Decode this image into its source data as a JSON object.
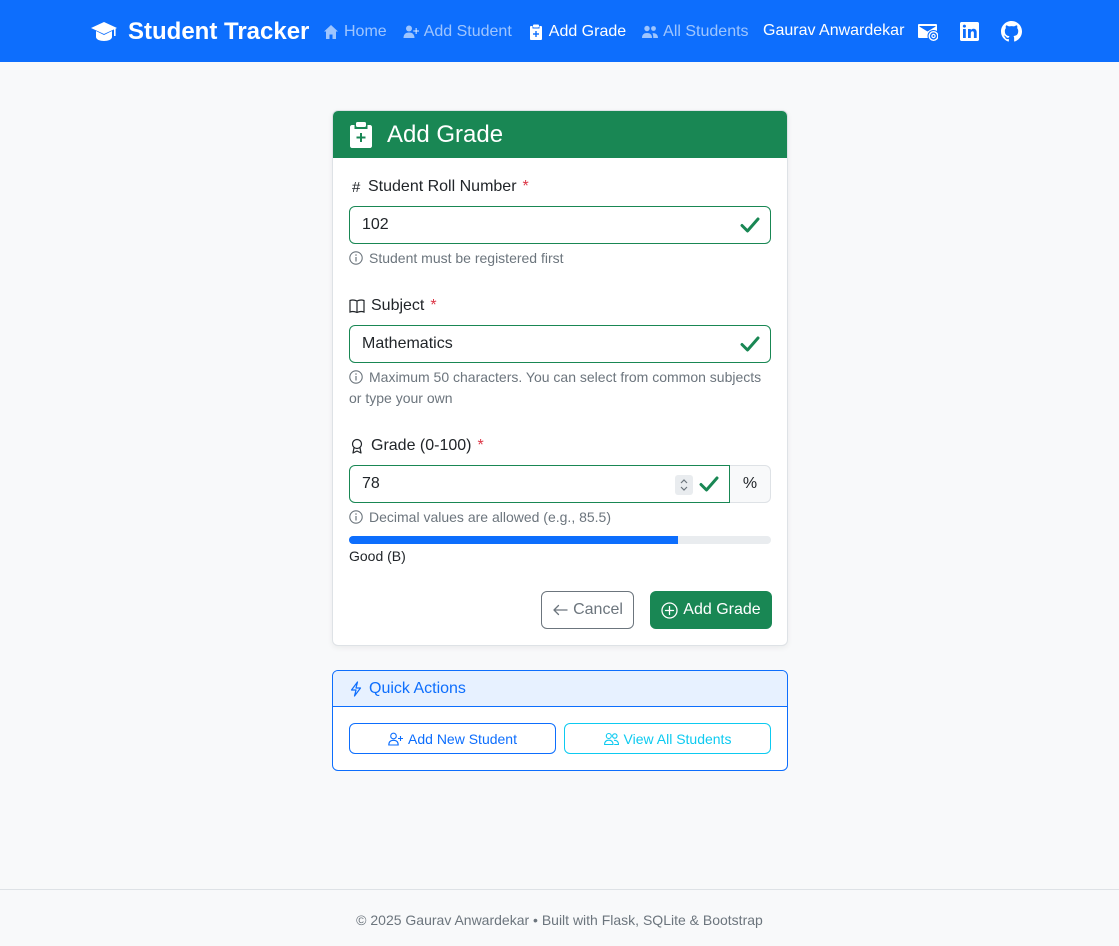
{
  "navbar": {
    "brand": "Student Tracker",
    "links": [
      {
        "label": "Home",
        "icon": "home-icon",
        "active": false
      },
      {
        "label": "Add Student",
        "icon": "user-plus-icon",
        "active": false
      },
      {
        "label": "Add Grade",
        "icon": "clipboard-plus-icon",
        "active": true
      },
      {
        "label": "All Students",
        "icon": "users-icon",
        "active": false
      }
    ],
    "user": "Gaurav Anwardekar",
    "social_icons": [
      "envelope-at-icon",
      "linkedin-icon",
      "github-icon"
    ]
  },
  "form": {
    "title": "Add Grade",
    "roll": {
      "label": "Student Roll Number",
      "required_mark": "*",
      "value": "102",
      "help": "Student must be registered first"
    },
    "subject": {
      "label": "Subject",
      "required_mark": "*",
      "value": "Mathematics",
      "help": "Maximum 50 characters. You can select from common subjects or type your own"
    },
    "grade": {
      "label": "Grade (0-100)",
      "required_mark": "*",
      "value": "78",
      "addon": "%",
      "help": "Decimal values are allowed (e.g., 85.5)",
      "progress_percent": 78,
      "grade_text": "Good (B)"
    },
    "cancel_label": "Cancel",
    "submit_label": "Add Grade"
  },
  "quick_actions": {
    "title": "Quick Actions",
    "add_student_label": "Add New Student",
    "view_students_label": "View All Students"
  },
  "footer": {
    "text": "© 2025 Gaurav Anwardekar • Built with Flask, SQLite & Bootstrap"
  },
  "colors": {
    "primary": "#0d6efd",
    "success": "#198754",
    "info": "#0dcaf0",
    "danger": "#dc3545"
  }
}
